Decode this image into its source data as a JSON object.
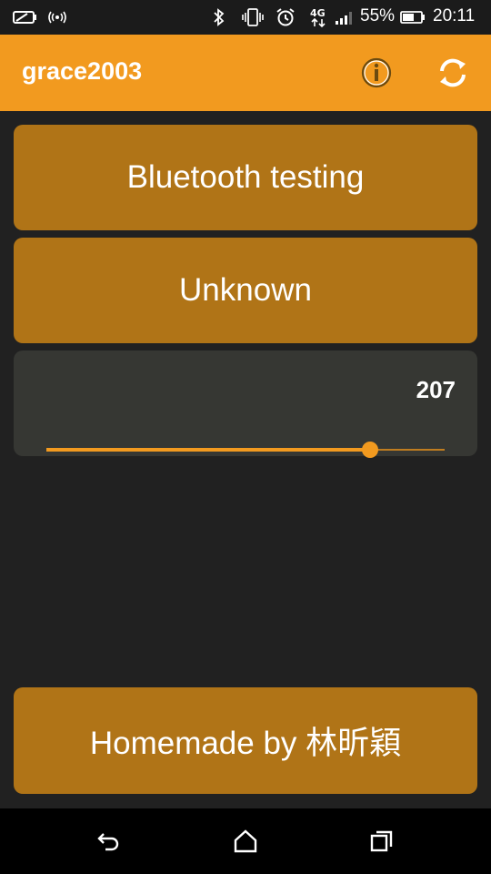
{
  "status_bar": {
    "battery": "55%",
    "time": "20:11",
    "icons": [
      "battery-saver-icon",
      "nfc-icon",
      "bluetooth-icon",
      "vibrate-icon",
      "alarm-icon",
      "4g-icon",
      "signal-icon",
      "battery-icon"
    ]
  },
  "app_bar": {
    "title": "grace2003",
    "actions": [
      "info-icon",
      "refresh-icon"
    ]
  },
  "main": {
    "bluetooth_button_label": "Bluetooth testing",
    "status_button_label": "Unknown",
    "slider": {
      "value_label": "207",
      "value": 207,
      "max": 255
    },
    "footer_button_label": "Homemade by 林昕穎"
  },
  "nav_bar": {
    "buttons": [
      "back-icon",
      "home-icon",
      "recents-icon"
    ]
  },
  "colors": {
    "accent": "#f29a1f",
    "button_bg": "#b07417",
    "background": "#212121",
    "slider_card_bg": "#363733"
  }
}
